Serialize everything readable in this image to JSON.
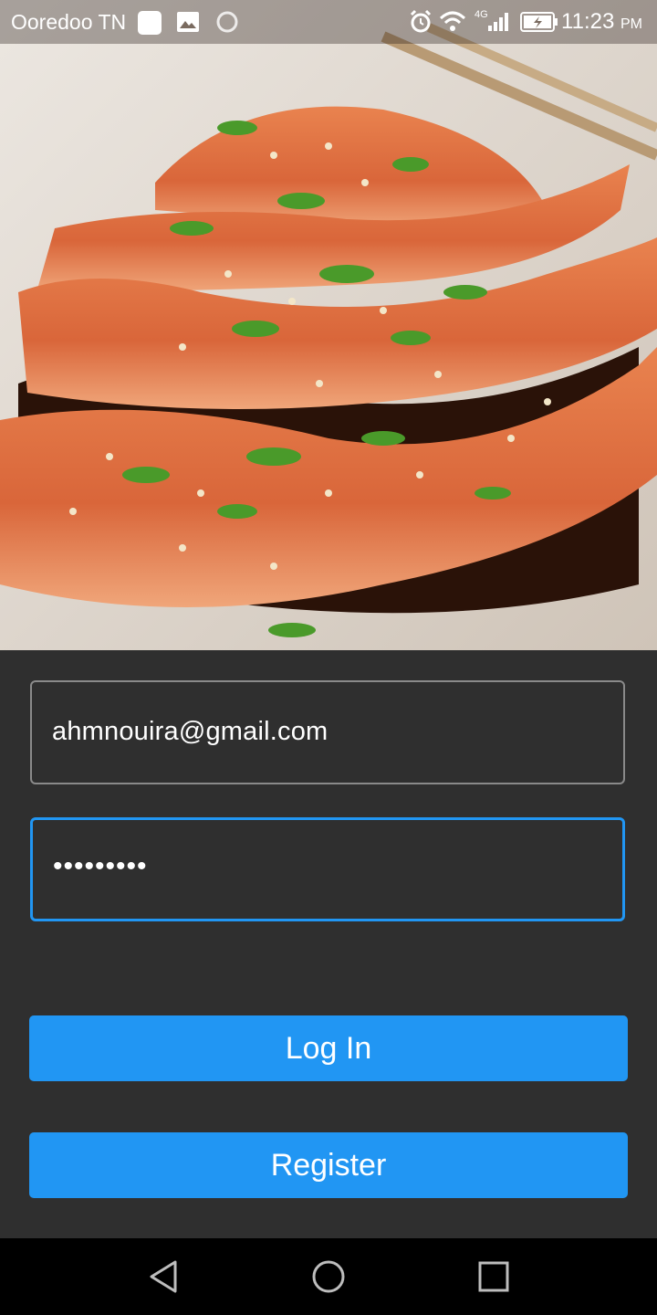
{
  "status_bar": {
    "carrier": "Ooredoo TN",
    "time": "11:23",
    "time_suffix": "PM",
    "network": "4G",
    "icons": [
      "whatsapp-icon",
      "gallery-icon",
      "sync-icon",
      "alarm-icon",
      "wifi-icon",
      "signal-icon",
      "battery-charging-icon"
    ]
  },
  "hero": {
    "image": "salmon-fillet-photo"
  },
  "form": {
    "email_value": "ahmnouira@gmail.com",
    "password_value": "•••••••••",
    "login_label": "Log In",
    "register_label": "Register"
  },
  "nav": {
    "icons": [
      "back-icon",
      "home-icon",
      "recents-icon"
    ]
  },
  "colors": {
    "accent": "#2196f3",
    "background": "#2f2f2f",
    "nav_background": "#000000"
  }
}
